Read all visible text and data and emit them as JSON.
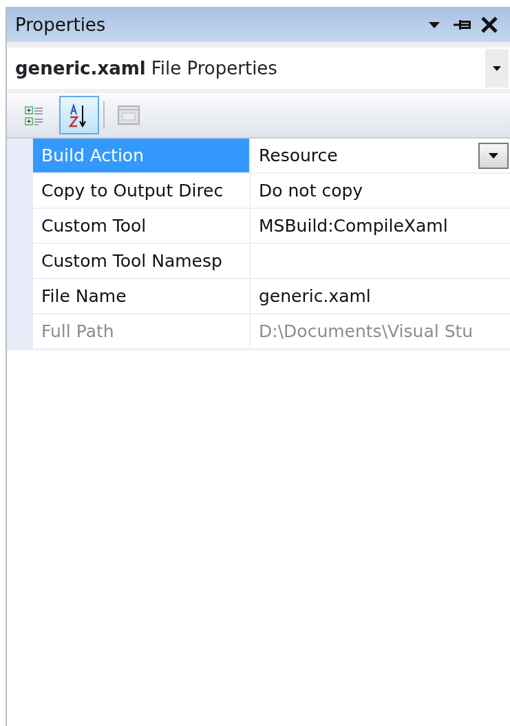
{
  "panel": {
    "title": "Properties"
  },
  "object_selector": {
    "name": "generic.xaml",
    "type": "File Properties"
  },
  "toolbar": [
    {
      "kind": "categorized",
      "selected": false,
      "disabled": false
    },
    {
      "kind": "alphabetical",
      "selected": true,
      "disabled": false
    },
    {
      "kind": "property-pages",
      "selected": false,
      "disabled": true
    }
  ],
  "properties": [
    {
      "name": "Build Action",
      "value": "Resource",
      "selected": true,
      "disabled": false
    },
    {
      "name": "Copy to Output Direc",
      "value": "Do not copy",
      "selected": false,
      "disabled": false
    },
    {
      "name": "Custom Tool",
      "value": "MSBuild:CompileXaml",
      "selected": false,
      "disabled": false
    },
    {
      "name": "Custom Tool Namesp",
      "selected": false,
      "disabled": false
    },
    {
      "name": "File Name",
      "value": "generic.xaml",
      "selected": false,
      "disabled": false
    },
    {
      "name": "Full Path",
      "value": "D:\\Documents\\Visual Stu",
      "selected": false,
      "disabled": true
    }
  ]
}
